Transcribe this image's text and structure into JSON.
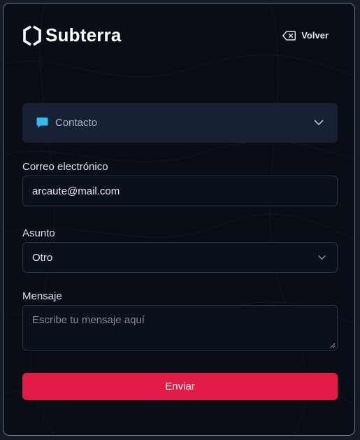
{
  "brand": {
    "name": "Subterra"
  },
  "header": {
    "back_label": "Volver",
    "back_icon": "backspace-icon"
  },
  "topic_selector": {
    "icon": "chat-bubble-icon",
    "label": "Contacto",
    "accent": "#38b6f2"
  },
  "form": {
    "email": {
      "label": "Correo electrónico",
      "value": "arcaute@mail.com"
    },
    "subject": {
      "label": "Asunto",
      "value": "Otro"
    },
    "message": {
      "label": "Mensaje",
      "placeholder": "Escribe tu mensaje aquí"
    },
    "submit_label": "Enviar",
    "submit_color": "#e21b47"
  }
}
